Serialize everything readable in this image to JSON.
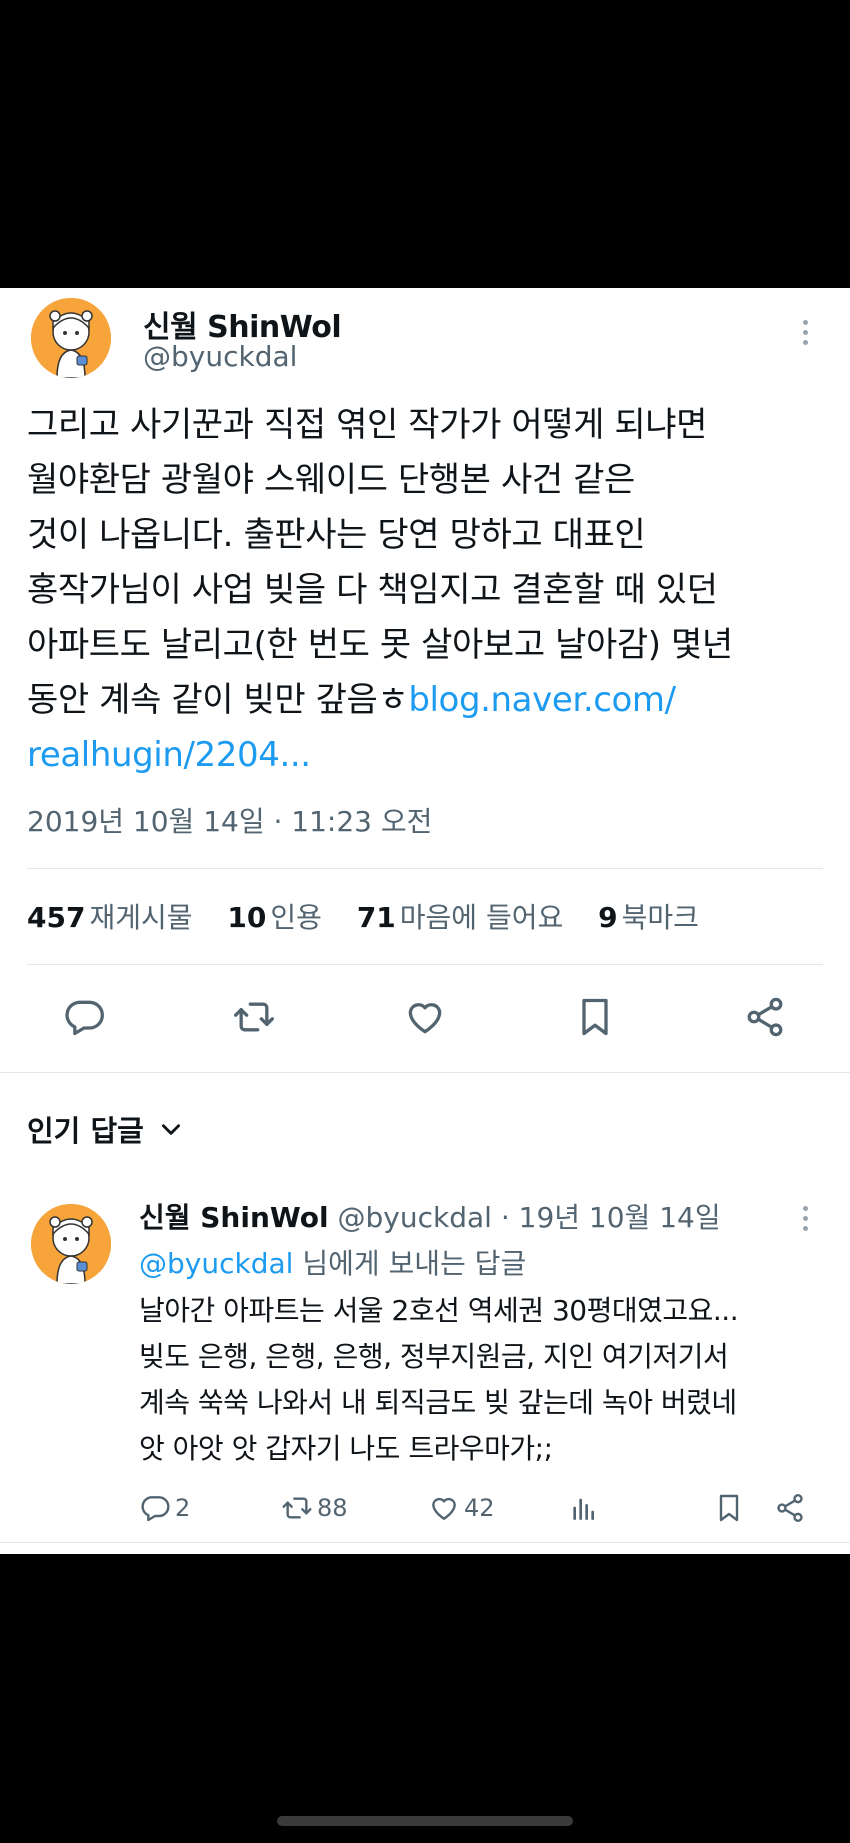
{
  "tweet": {
    "author_name": "신월 ShinWol",
    "author_handle": "@byuckdal",
    "body_lines": [
      "그리고 사기꾼과 직접 엮인 작가가 어떻게 되냐면",
      "월야환담 광월야 스웨이드 단행본 사건 같은",
      "것이 나옵니다. 출판사는 당연 망하고 대표인",
      "홍작가님이 사업 빚을 다 책임지고 결혼할 때 있던",
      "아파트도 날리고(한 번도 못 살아보고 날아감) 몇년"
    ],
    "body_last_text": "동안 계속 같이 빚만 갚음ㅎ",
    "link_part1": "blog.naver.com/",
    "link_part2": "realhugin/2204...",
    "timestamp": "2019년 10월 14일 · 11:23 오전",
    "stats": {
      "retweets": "457",
      "retweets_label": "재게시물",
      "quotes": "10",
      "quotes_label": "인용",
      "likes": "71",
      "likes_label": "마음에 들어요",
      "bookmarks": "9",
      "bookmarks_label": "북마크"
    },
    "actions": [
      "reply-icon",
      "retweet-icon",
      "like-icon",
      "bookmark-icon",
      "share-icon"
    ]
  },
  "popular_replies": {
    "label": "인기 답글",
    "icon": "chevron-down-icon"
  },
  "reply": {
    "author_name": "신월 ShinWol",
    "meta": "@byuckdal · 19년 10월 14일",
    "reply_to_handle": "@byuckdal",
    "reply_to_suffix": " 님에게 보내는 답글",
    "body_lines": [
      "날아간 아파트는 서울 2호선 역세권 30평대였고요...",
      "빚도 은행, 은행, 은행, 정부지원금, 지인 여기저기서",
      "계속 쑥쑥 나와서 내 퇴직금도 빚 갚는데 녹아 버렸네",
      "앗 아앗 앗 갑자기 나도 트라우마가;;"
    ],
    "reply_count": "2",
    "retweet_count": "88",
    "like_count": "42"
  },
  "colors": {
    "link": "#1d9bf0",
    "secondary_text": "#536471",
    "primary_text": "#0f1419",
    "background": "#000000",
    "card": "#ffffff"
  }
}
